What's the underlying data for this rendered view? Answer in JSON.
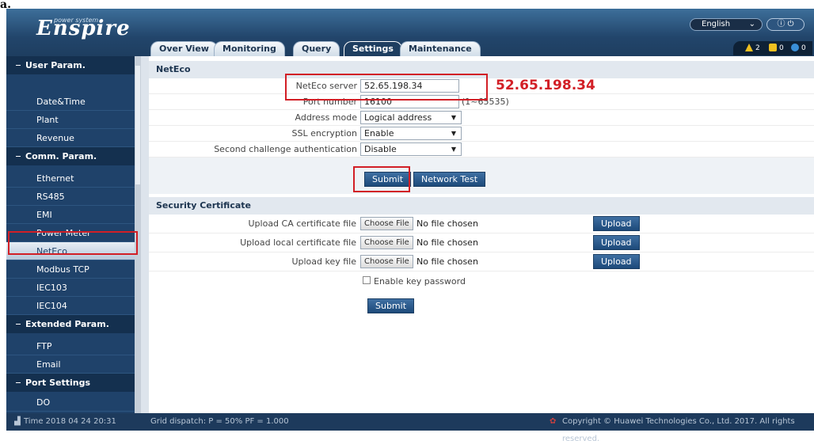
{
  "annotation_letter": "a.",
  "header": {
    "logo": "Enspire",
    "logo_sub": "power system",
    "language": "English",
    "power_icons": "ⓘ ⏻",
    "tabs": [
      "Over View",
      "Monitoring",
      "Query",
      "Settings",
      "Maintenance"
    ],
    "active_tab": "Settings",
    "alerts": [
      {
        "icon": "warning-icon",
        "count": "2"
      },
      {
        "icon": "alarm-icon",
        "count": "0"
      },
      {
        "icon": "info-icon",
        "count": "0"
      }
    ]
  },
  "sidebar": {
    "groups": [
      {
        "title": "User Param.",
        "items": [
          "Date&Time",
          "Plant",
          "Revenue"
        ]
      },
      {
        "title": "Comm. Param.",
        "items": [
          "Ethernet",
          "RS485",
          "EMI",
          "Power Meter",
          "NetEco",
          "Modbus TCP",
          "IEC103",
          "IEC104"
        ]
      },
      {
        "title": "Extended Param.",
        "items": [
          "FTP",
          "Email"
        ]
      },
      {
        "title": "Port Settings",
        "items": [
          "DO"
        ]
      }
    ],
    "active_item": "NetEco"
  },
  "neteco": {
    "title": "NetEco",
    "server_label": "NetEco server",
    "server_value": "52.65.198.34",
    "port_label": "Port number",
    "port_value": "16100",
    "port_range": "(1~65535)",
    "address_label": "Address mode",
    "address_value": "Logical address",
    "ssl_label": "SSL encryption",
    "ssl_value": "Enable",
    "challenge_label": "Second challenge authentication",
    "challenge_value": "Disable",
    "submit": "Submit",
    "network_test": "Network Test"
  },
  "callout_ip": "52.65.198.34",
  "security": {
    "title": "Security Certificate",
    "rows": [
      {
        "label": "Upload CA certificate file",
        "choose": "Choose File",
        "nofile": "No file chosen",
        "upload": "Upload"
      },
      {
        "label": "Upload local certificate file",
        "choose": "Choose File",
        "nofile": "No file chosen",
        "upload": "Upload"
      },
      {
        "label": "Upload key file",
        "choose": "Choose File",
        "nofile": "No file chosen",
        "upload": "Upload"
      }
    ],
    "key_password": "Enable key password",
    "submit": "Submit"
  },
  "footer": {
    "time": "Time  2018 04 24 20:31",
    "grid": "Grid dispatch: P = 50% PF = 1.000",
    "copyright": "Copyright © Huawei Technologies Co., Ltd. 2017. All rights reserved."
  },
  "colors": {
    "accent": "#1f426a",
    "highlight": "#d21f26"
  }
}
